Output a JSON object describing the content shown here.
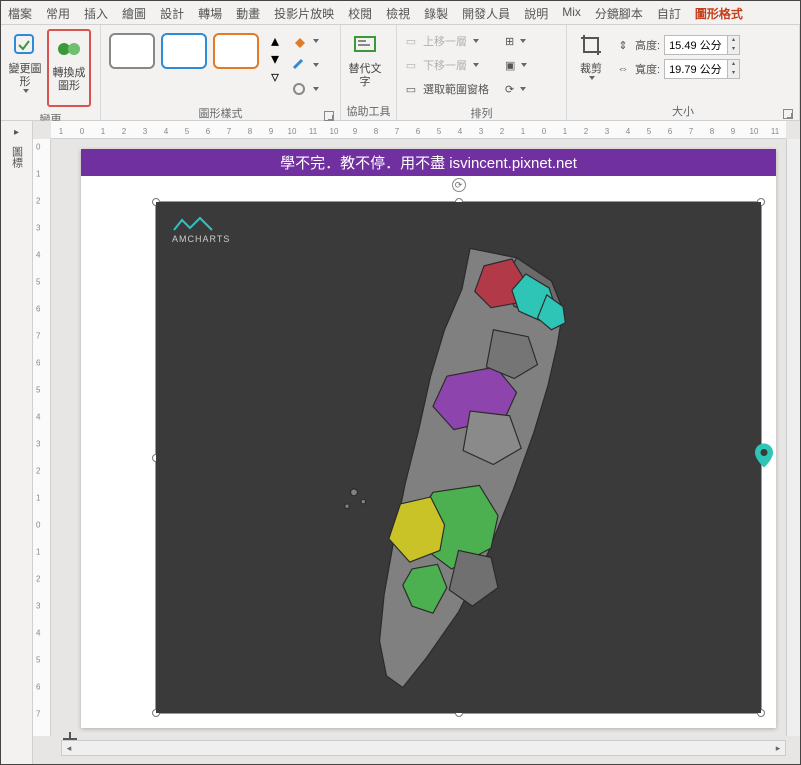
{
  "tabs": {
    "items": [
      "檔案",
      "常用",
      "插入",
      "繪圖",
      "設計",
      "轉場",
      "動畫",
      "投影片放映",
      "校閱",
      "檢視",
      "錄製",
      "開發人員",
      "說明",
      "Mix",
      "分鏡腳本",
      "自訂",
      "圖形格式"
    ],
    "active": "圖形格式"
  },
  "ribbon": {
    "change": {
      "label": "變更",
      "changeShape": "變更圖形",
      "convert": "轉換成圖形"
    },
    "shapeStyle": {
      "label": "圖形樣式",
      "fill": "圖形填滿",
      "outline": "圖形外框",
      "effects": "圖形效果"
    },
    "a11y": {
      "label": "協助工具",
      "altText": "替代文字"
    },
    "arrange": {
      "label": "排列",
      "bringForward": "上移一層",
      "sendBackward": "下移一層",
      "selectionPane": "選取範圍窗格"
    },
    "size": {
      "label": "大小",
      "crop": "裁剪",
      "heightLabel": "高度:",
      "widthLabel": "寬度:",
      "heightValue": "15.49 公分",
      "widthValue": "19.79 公分"
    }
  },
  "leftPanel": {
    "label": "圖標"
  },
  "slide": {
    "banner": "學不完．教不停．用不盡 isvincent.pixnet.net",
    "logo": "AMCHARTS"
  },
  "ruler": {
    "h": [
      "1",
      "0",
      "1",
      "2",
      "3",
      "4",
      "5",
      "6",
      "7",
      "8",
      "9",
      "10",
      "11",
      "10",
      "9",
      "8",
      "7",
      "6",
      "5",
      "4",
      "3",
      "2",
      "1",
      "0",
      "1",
      "2",
      "3",
      "4",
      "5",
      "6",
      "7",
      "8",
      "9",
      "10",
      "11"
    ],
    "v": [
      "0",
      "1",
      "2",
      "3",
      "4",
      "5",
      "6",
      "7",
      "6",
      "5",
      "4",
      "3",
      "2",
      "1",
      "0",
      "1",
      "2",
      "3",
      "4",
      "5",
      "6",
      "7"
    ]
  }
}
